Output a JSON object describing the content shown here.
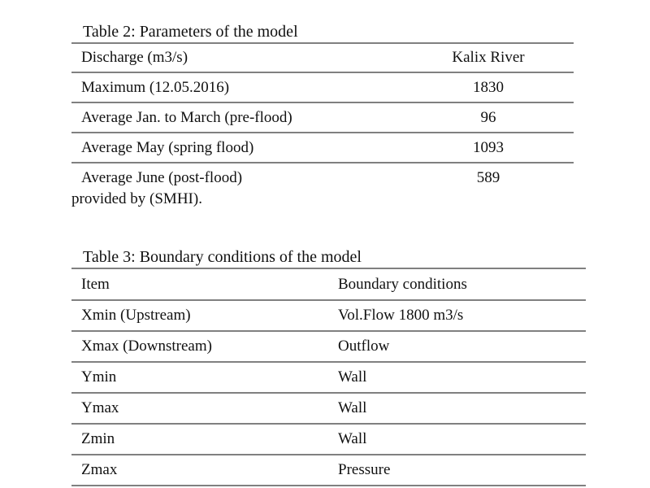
{
  "document": {
    "background_color": "#ffffff",
    "text_color": "#111111",
    "rule_color": "#808080"
  },
  "table2": {
    "title": "Table 2: Parameters of the model",
    "columns": [
      "Discharge (m3/s)",
      "Kalix River"
    ],
    "rows": [
      {
        "item": "Maximum (12.05.2016)",
        "value": "1830"
      },
      {
        "item": "Average Jan. to March (pre-flood)",
        "value": "96"
      },
      {
        "item": "Average May (spring flood)",
        "value": "1093"
      },
      {
        "item": "Average June (post-flood)",
        "value": "589"
      }
    ],
    "note": "provided by (SMHI)."
  },
  "table3": {
    "title": "Table 3: Boundary conditions of the model",
    "columns": [
      "Item",
      "Boundary conditions"
    ],
    "rows": [
      {
        "item": "Xmin (Upstream)",
        "value": "Vol.Flow 1800 m3/s"
      },
      {
        "item": "Xmax (Downstream)",
        "value": "Outflow"
      },
      {
        "item": "Ymin",
        "value": "Wall"
      },
      {
        "item": "Ymax",
        "value": "Wall"
      },
      {
        "item": "Zmin",
        "value": "Wall"
      },
      {
        "item": "Zmax",
        "value": "Pressure"
      }
    ]
  }
}
